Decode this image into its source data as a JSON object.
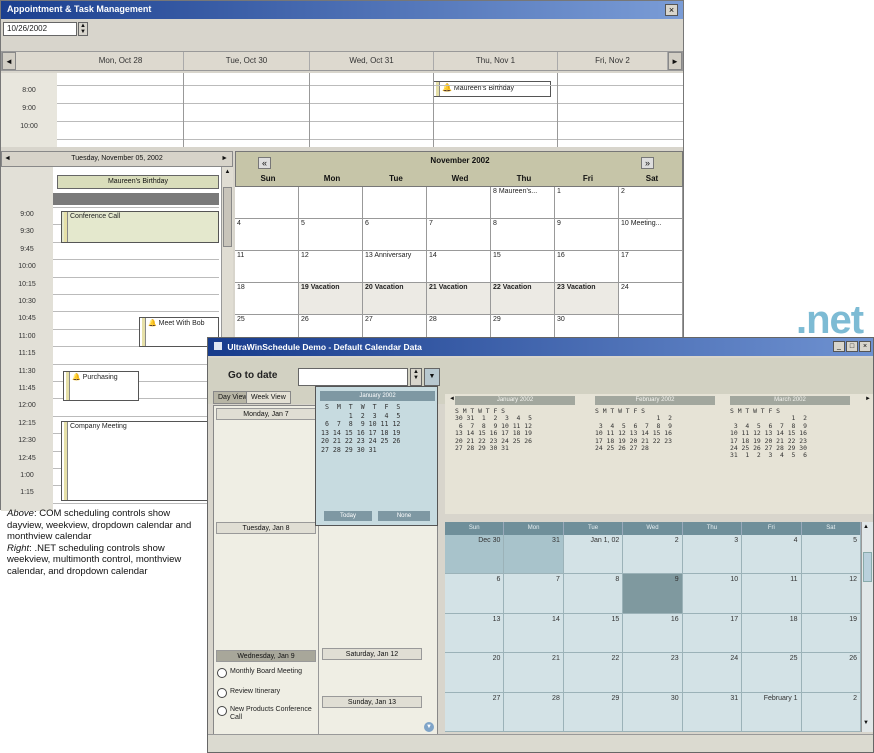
{
  "com_window": {
    "title": "Appointment & Task Management",
    "date_value": "10/26/2002",
    "week_days": [
      "Mon, Oct 28",
      "Tue, Oct 30",
      "Wed, Oct 31",
      "Thu, Nov 1",
      "Fri, Nov 2"
    ],
    "week_times": [
      "8:00",
      "9:00",
      "10:00"
    ],
    "week_appointment": "Maureen's Birthday",
    "day_title": "Tuesday, November 05, 2002",
    "day_allday": "Maureen's Birthday",
    "day_times": [
      "9:00",
      "9:30",
      "9:45",
      "10:00",
      "10:15",
      "10:30",
      "10:45",
      "11:00",
      "11:15",
      "11:30",
      "11:45",
      "12:00",
      "12:15",
      "12:30",
      "12:45",
      "1:00",
      "1:15"
    ],
    "day_appointments": {
      "conf": "Conference Call",
      "meet": "Meet With Bob",
      "purchase": "Purchasing",
      "company": "Company Meeting"
    },
    "month": {
      "title": "November 2002",
      "weekdays": [
        "Sun",
        "Mon",
        "Tue",
        "Wed",
        "Thu",
        "Fri",
        "Sat"
      ],
      "rows": [
        [
          "",
          "",
          "",
          "",
          "8 Maureen's...",
          "1",
          "2"
        ],
        [
          "4",
          "5",
          "6",
          "7",
          "8",
          "9",
          "10 Meeting..."
        ],
        [
          "11",
          "12",
          "13 Anniversary",
          "14",
          "15",
          "16",
          "17"
        ],
        [
          "18",
          "19 Vacation",
          "20 Vacation",
          "21 Vacation",
          "22 Vacation",
          "23 Vacation",
          "24"
        ],
        [
          "25",
          "26",
          "27",
          "28",
          "29",
          "30",
          ""
        ]
      ]
    }
  },
  "caption": {
    "above_label": "Above",
    "above_text": ": COM scheduling controls show dayview, weekview, dropdown calendar and monthview calendar",
    "right_label": "Right",
    "right_text": ": .NET scheduling controls  show weekview, multimonth control, monthview calendar, and dropdown calendar"
  },
  "net_label": ".net",
  "net_window": {
    "title": "UltraWinSchedule Demo - Default Calendar Data",
    "goto_label": "Go to date",
    "tabs": [
      "Day View",
      "Week View"
    ],
    "week_days": [
      "Monday, Jan 7",
      "Tuesday, Jan 8",
      "Wednesday, Jan 9",
      "Saturday, Jan 12",
      "Sunday, Jan 13"
    ],
    "week_appointments": [
      "Monthly Board Meeting",
      "Review Itinerary",
      "New Products Conference Call"
    ],
    "dropdown": {
      "title": "January 2002",
      "today_label": "Today",
      "none_label": "None"
    },
    "multimonth": [
      {
        "title": "January 2002",
        "grid": "S M T W T F S\n30 31  1  2  3  4  5\n 6  7  8  9 10 11 12\n13 14 15 16 17 18 19\n20 21 22 23 24 25 26\n27 28 29 30 31"
      },
      {
        "title": "February 2002",
        "grid": "S M T W T F S\n                1  2\n 3  4  5  6  7  8  9\n10 11 12 13 14 15 16\n17 18 19 20 21 22 23\n24 25 26 27 28"
      },
      {
        "title": "March 2002",
        "grid": "S M T W T F S\n                1  2\n 3  4  5  6  7  8  9\n10 11 12 13 14 15 16\n17 18 19 20 21 22 23\n24 25 26 27 28 29 30\n31  1  2  3  4  5  6"
      }
    ],
    "month_weekdays": [
      "Sun",
      "Mon",
      "Tue",
      "Wed",
      "Thu",
      "Fri",
      "Sat"
    ],
    "month_rows": [
      [
        "Dec 30",
        "31",
        "Jan 1, 02",
        "2",
        "3",
        "4",
        "5"
      ],
      [
        "6",
        "7",
        "8",
        "9",
        "10",
        "11",
        "12"
      ],
      [
        "13",
        "14",
        "15",
        "16",
        "17",
        "18",
        "19"
      ],
      [
        "20",
        "21",
        "22",
        "23",
        "24",
        "25",
        "26"
      ],
      [
        "27",
        "28",
        "29",
        "30",
        "31",
        "February 1",
        "2"
      ]
    ]
  }
}
